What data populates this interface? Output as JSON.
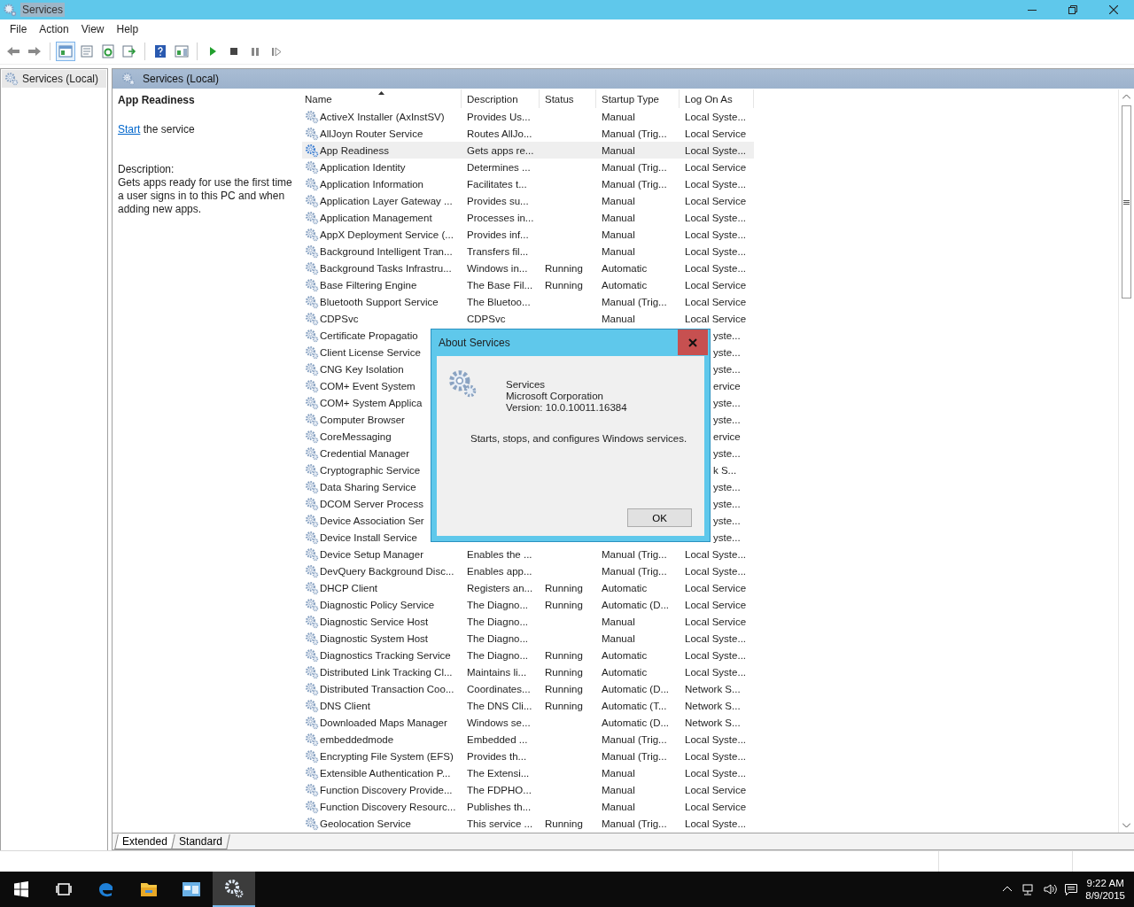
{
  "window": {
    "title": "Services"
  },
  "menu": [
    "File",
    "Action",
    "View",
    "Help"
  ],
  "toolbar": {
    "console_tree_pressed": true
  },
  "tree": [
    {
      "label": "Services (Local)",
      "selected": true
    }
  ],
  "panel": {
    "title": "Services (Local)"
  },
  "details": {
    "service_name": "App Readiness",
    "action_link": "Start",
    "action_text": "the service",
    "description_label": "Description:",
    "description": "Gets apps ready for use the first time a user signs in to this PC and when adding new apps."
  },
  "table": {
    "columns": [
      {
        "label": "Name",
        "sorted": true
      },
      {
        "label": "Description",
        "sorted": false
      },
      {
        "label": "Status",
        "sorted": false
      },
      {
        "label": "Startup Type",
        "sorted": false
      },
      {
        "label": "Log On As",
        "sorted": false
      }
    ],
    "rows": [
      {
        "name": "ActiveX Installer (AxInstSV)",
        "description": "Provides Us...",
        "startup_type": "Manual",
        "log_on_as": "Local Syste...",
        "selected": false
      },
      {
        "name": "AllJoyn Router Service",
        "description": "Routes AllJo...",
        "startup_type": "Manual (Trig...",
        "log_on_as": "Local Service",
        "selected": false
      },
      {
        "name": "App Readiness",
        "description": "Gets apps re...",
        "startup_type": "Manual",
        "log_on_as": "Local Syste...",
        "selected": true
      },
      {
        "name": "Application Identity",
        "description": "Determines ...",
        "startup_type": "Manual (Trig...",
        "log_on_as": "Local Service",
        "selected": false
      },
      {
        "name": "Application Information",
        "description": "Facilitates t...",
        "startup_type": "Manual (Trig...",
        "log_on_as": "Local Syste...",
        "selected": false
      },
      {
        "name": "Application Layer Gateway ...",
        "description": "Provides su...",
        "startup_type": "Manual",
        "log_on_as": "Local Service",
        "selected": false
      },
      {
        "name": "Application Management",
        "description": "Processes in...",
        "startup_type": "Manual",
        "log_on_as": "Local Syste...",
        "selected": false
      },
      {
        "name": "AppX Deployment Service (...",
        "description": "Provides inf...",
        "startup_type": "Manual",
        "log_on_as": "Local Syste...",
        "selected": false
      },
      {
        "name": "Background Intelligent Tran...",
        "description": "Transfers fil...",
        "startup_type": "Manual",
        "log_on_as": "Local Syste...",
        "selected": false
      },
      {
        "name": "Background Tasks Infrastru...",
        "description": "Windows in...",
        "status": "Running",
        "startup_type": "Automatic",
        "log_on_as": "Local Syste...",
        "selected": false
      },
      {
        "name": "Base Filtering Engine",
        "description": "The Base Fil...",
        "status": "Running",
        "startup_type": "Automatic",
        "log_on_as": "Local Service",
        "selected": false
      },
      {
        "name": "Bluetooth Support Service",
        "description": "The Bluetoo...",
        "startup_type": "Manual (Trig...",
        "log_on_as": "Local Service",
        "selected": false
      },
      {
        "name": "CDPSvc",
        "description": "CDPSvc",
        "startup_type": "Manual",
        "log_on_as": "Local Service",
        "selected": false
      },
      {
        "name": "Certificate Propagatio",
        "log_on_as": "yste...",
        "selected": false
      },
      {
        "name": "Client License Service",
        "log_on_as": "yste...",
        "selected": false
      },
      {
        "name": "CNG Key Isolation",
        "log_on_as": "yste...",
        "selected": false
      },
      {
        "name": "COM+ Event System",
        "log_on_as": "ervice",
        "selected": false
      },
      {
        "name": "COM+ System Applica",
        "log_on_as": "yste...",
        "selected": false
      },
      {
        "name": "Computer Browser",
        "log_on_as": "yste...",
        "selected": false
      },
      {
        "name": "CoreMessaging",
        "log_on_as": "ervice",
        "selected": false
      },
      {
        "name": "Credential Manager",
        "log_on_as": "yste...",
        "selected": false
      },
      {
        "name": "Cryptographic Service",
        "log_on_as": "k S...",
        "selected": false
      },
      {
        "name": "Data Sharing Service",
        "log_on_as": "yste...",
        "selected": false
      },
      {
        "name": "DCOM Server Process",
        "log_on_as": "yste...",
        "selected": false
      },
      {
        "name": "Device Association Ser",
        "log_on_as": "yste...",
        "selected": false
      },
      {
        "name": "Device Install Service",
        "log_on_as": "yste...",
        "selected": false
      },
      {
        "name": "Device Setup Manager",
        "description": "Enables the ...",
        "startup_type": "Manual (Trig...",
        "log_on_as": "Local Syste...",
        "selected": false
      },
      {
        "name": "DevQuery Background Disc...",
        "description": "Enables app...",
        "startup_type": "Manual (Trig...",
        "log_on_as": "Local Syste...",
        "selected": false
      },
      {
        "name": "DHCP Client",
        "description": "Registers an...",
        "status": "Running",
        "startup_type": "Automatic",
        "log_on_as": "Local Service",
        "selected": false
      },
      {
        "name": "Diagnostic Policy Service",
        "description": "The Diagno...",
        "status": "Running",
        "startup_type": "Automatic (D...",
        "log_on_as": "Local Service",
        "selected": false
      },
      {
        "name": "Diagnostic Service Host",
        "description": "The Diagno...",
        "startup_type": "Manual",
        "log_on_as": "Local Service",
        "selected": false
      },
      {
        "name": "Diagnostic System Host",
        "description": "The Diagno...",
        "startup_type": "Manual",
        "log_on_as": "Local Syste...",
        "selected": false
      },
      {
        "name": "Diagnostics Tracking Service",
        "description": "The Diagno...",
        "status": "Running",
        "startup_type": "Automatic",
        "log_on_as": "Local Syste...",
        "selected": false
      },
      {
        "name": "Distributed Link Tracking Cl...",
        "description": "Maintains li...",
        "status": "Running",
        "startup_type": "Automatic",
        "log_on_as": "Local Syste...",
        "selected": false
      },
      {
        "name": "Distributed Transaction Coo...",
        "description": "Coordinates...",
        "status": "Running",
        "startup_type": "Automatic (D...",
        "log_on_as": "Network S...",
        "selected": false
      },
      {
        "name": "DNS Client",
        "description": "The DNS Cli...",
        "status": "Running",
        "startup_type": "Automatic (T...",
        "log_on_as": "Network S...",
        "selected": false
      },
      {
        "name": "Downloaded Maps Manager",
        "description": "Windows se...",
        "startup_type": "Automatic (D...",
        "log_on_as": "Network S...",
        "selected": false
      },
      {
        "name": "embeddedmode",
        "description": "Embedded ...",
        "startup_type": "Manual (Trig...",
        "log_on_as": "Local Syste...",
        "selected": false
      },
      {
        "name": "Encrypting File System (EFS)",
        "description": "Provides th...",
        "startup_type": "Manual (Trig...",
        "log_on_as": "Local Syste...",
        "selected": false
      },
      {
        "name": "Extensible Authentication P...",
        "description": "The Extensi...",
        "startup_type": "Manual",
        "log_on_as": "Local Syste...",
        "selected": false
      },
      {
        "name": "Function Discovery Provide...",
        "description": "The FDPHO...",
        "startup_type": "Manual",
        "log_on_as": "Local Service",
        "selected": false
      },
      {
        "name": "Function Discovery Resourc...",
        "description": "Publishes th...",
        "startup_type": "Manual",
        "log_on_as": "Local Service",
        "selected": false
      },
      {
        "name": "Geolocation Service",
        "description": "This service ...",
        "status": "Running",
        "startup_type": "Manual (Trig...",
        "log_on_as": "Local Syste...",
        "selected": false
      }
    ]
  },
  "view_tabs": [
    {
      "label": "Extended",
      "selected": true
    },
    {
      "label": "Standard",
      "selected": false
    }
  ],
  "dialog": {
    "title": "About Services",
    "product": "Services",
    "company": "Microsoft Corporation",
    "version": "Version: 10.0.10011.16384",
    "summary": "Starts, stops, and configures Windows services.",
    "buttons": [
      "OK"
    ]
  },
  "taskbar": {
    "apps": [
      {
        "kind": "task_view",
        "selected": false
      },
      {
        "kind": "edge",
        "selected": false
      },
      {
        "kind": "explorer",
        "selected": false
      },
      {
        "kind": "control_panel",
        "selected": false
      },
      {
        "kind": "services",
        "selected": true
      }
    ],
    "clock": {
      "time": "9:22 AM",
      "date": "8/9/2015"
    }
  }
}
